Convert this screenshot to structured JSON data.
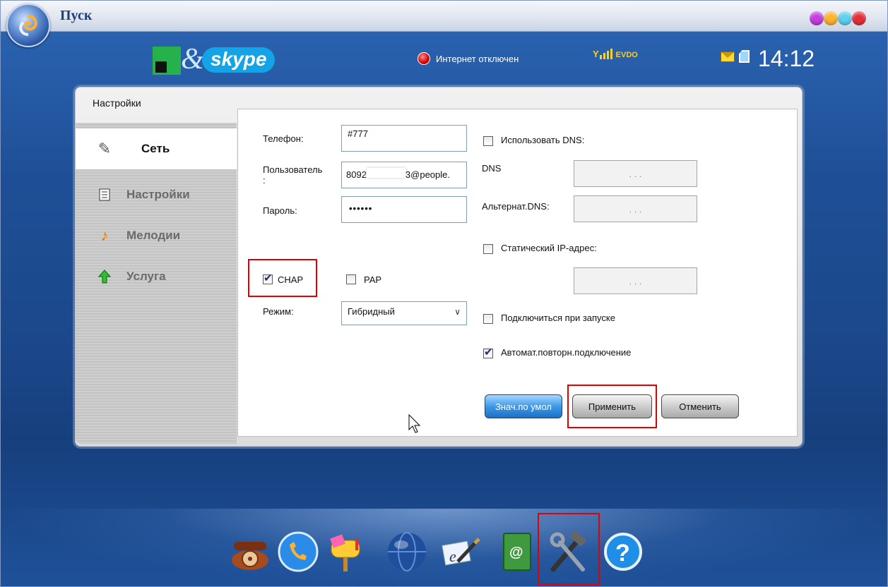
{
  "window": {
    "title": "Пуск",
    "start_icon": "swirl-orb-icon",
    "window_buttons": [
      "purple",
      "orange",
      "cyan",
      "red"
    ]
  },
  "header": {
    "logo_text": "skype",
    "logo_amp": "&",
    "internet_status": "Интернет отключен",
    "signal_network": "EVDO",
    "time": "14:12"
  },
  "panel": {
    "title": "Настройки",
    "sidebar": {
      "items": [
        {
          "label": "Сеть",
          "icon": "pencil-icon",
          "active": true
        },
        {
          "label": "Настройки",
          "icon": "list-icon",
          "active": false
        },
        {
          "label": "Мелодии",
          "icon": "music-note-icon",
          "active": false
        },
        {
          "label": "Услуга",
          "icon": "green-arrow-up-icon",
          "active": false
        }
      ]
    },
    "form": {
      "phone_label": "Телефон:",
      "phone_value": "#777",
      "user_label": "Пользователь\n:",
      "user_value_prefix": "8092",
      "user_value_suffix": "3@people.",
      "password_label": "Пароль:",
      "password_value": "••••••",
      "chap_label": "CHAP",
      "chap_checked": true,
      "pap_label": "PAP",
      "pap_checked": false,
      "mode_label": "Режим:",
      "mode_value": "Гибридный",
      "use_dns_label": "Использовать DNS:",
      "use_dns_checked": false,
      "dns_label": "DNS",
      "alt_dns_label": "Альтернат.DNS:",
      "static_ip_label": "Статический IP-адрес:",
      "static_ip_checked": false,
      "connect_on_start_label": "Подключиться при запуске",
      "connect_on_start_checked": false,
      "auto_reconnect_label": "Автомат.повторн.подключение",
      "auto_reconnect_checked": true,
      "ip_dots": ". . ."
    },
    "buttons": {
      "defaults": "Знач.по умол",
      "apply": "Применить",
      "cancel": "Отменить"
    }
  },
  "dock": {
    "items": [
      {
        "name": "phone",
        "icon": "rotary-phone-icon"
      },
      {
        "name": "skype-call",
        "icon": "skype-call-icon"
      },
      {
        "name": "mailbox",
        "icon": "mailbox-icon"
      },
      {
        "name": "internet",
        "icon": "globe-icon"
      },
      {
        "name": "notes",
        "icon": "pen-paper-icon"
      },
      {
        "name": "contacts",
        "icon": "address-book-icon"
      },
      {
        "name": "tools",
        "icon": "hammer-wrench-icon"
      },
      {
        "name": "help",
        "icon": "question-mark-icon"
      }
    ]
  },
  "colors": {
    "highlight_red": "#e30000",
    "background_blue": "#1d4d8e",
    "evdo_yellow": "#ffcf1a"
  }
}
